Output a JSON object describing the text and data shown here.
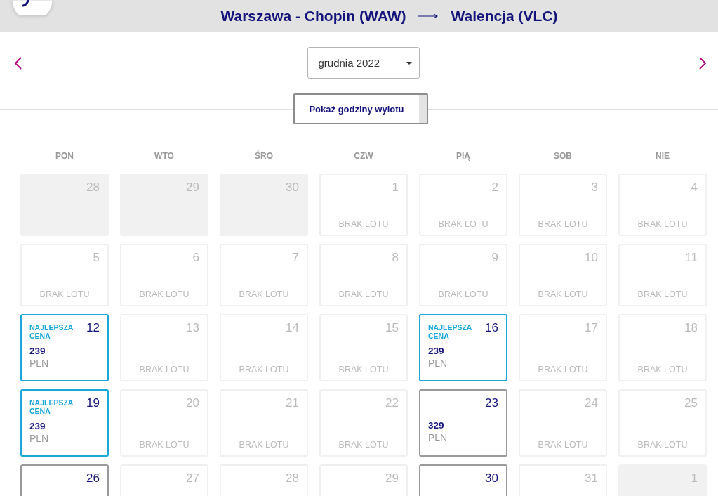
{
  "header": {
    "origin": "Warszawa - Chopin (WAW)",
    "destination": "Walencja (VLC)"
  },
  "month_picker": {
    "value": "grudnia 2022"
  },
  "toggle_button": {
    "label": "Pokaż godziny wylotu"
  },
  "weekdays": [
    "PON",
    "WTO",
    "ŚRO",
    "CZW",
    "PIĄ",
    "SOB",
    "NIE"
  ],
  "days": [
    {
      "day": "28",
      "kind": "outside"
    },
    {
      "day": "29",
      "kind": "outside"
    },
    {
      "day": "30",
      "kind": "outside"
    },
    {
      "day": "1",
      "kind": "empty",
      "note": "BRAK LOTU"
    },
    {
      "day": "2",
      "kind": "empty",
      "note": "BRAK LOTU"
    },
    {
      "day": "3",
      "kind": "empty",
      "note": "BRAK LOTU"
    },
    {
      "day": "4",
      "kind": "empty",
      "note": "BRAK LOTU"
    },
    {
      "day": "5",
      "kind": "empty",
      "note": "BRAK LOTU"
    },
    {
      "day": "6",
      "kind": "empty",
      "note": "BRAK LOTU"
    },
    {
      "day": "7",
      "kind": "empty",
      "note": "BRAK LOTU"
    },
    {
      "day": "8",
      "kind": "empty",
      "note": "BRAK LOTU"
    },
    {
      "day": "9",
      "kind": "empty",
      "note": "BRAK LOTU"
    },
    {
      "day": "10",
      "kind": "empty",
      "note": "BRAK LOTU"
    },
    {
      "day": "11",
      "kind": "empty",
      "note": "BRAK LOTU"
    },
    {
      "day": "12",
      "kind": "best",
      "badge": "NAJLEPSZA CENA",
      "price": "239",
      "currency": "PLN"
    },
    {
      "day": "13",
      "kind": "empty",
      "note": "BRAK LOTU"
    },
    {
      "day": "14",
      "kind": "empty",
      "note": "BRAK LOTU"
    },
    {
      "day": "15",
      "kind": "empty",
      "note": "BRAK LOTU"
    },
    {
      "day": "16",
      "kind": "best",
      "badge": "NAJLEPSZA CENA",
      "price": "239",
      "currency": "PLN"
    },
    {
      "day": "17",
      "kind": "empty",
      "note": "BRAK LOTU"
    },
    {
      "day": "18",
      "kind": "empty",
      "note": "BRAK LOTU"
    },
    {
      "day": "19",
      "kind": "best",
      "badge": "NAJLEPSZA CENA",
      "price": "239",
      "currency": "PLN"
    },
    {
      "day": "20",
      "kind": "empty",
      "note": "BRAK LOTU"
    },
    {
      "day": "21",
      "kind": "empty",
      "note": "BRAK LOTU"
    },
    {
      "day": "22",
      "kind": "empty",
      "note": "BRAK LOTU"
    },
    {
      "day": "23",
      "kind": "available",
      "price": "329",
      "currency": "PLN"
    },
    {
      "day": "24",
      "kind": "empty",
      "note": "BRAK LOTU"
    },
    {
      "day": "25",
      "kind": "empty",
      "note": "BRAK LOTU"
    },
    {
      "day": "26",
      "kind": "available"
    },
    {
      "day": "27",
      "kind": "empty"
    },
    {
      "day": "28",
      "kind": "empty"
    },
    {
      "day": "29",
      "kind": "empty"
    },
    {
      "day": "30",
      "kind": "available"
    },
    {
      "day": "31",
      "kind": "empty"
    },
    {
      "day": "1",
      "kind": "outside"
    }
  ]
}
